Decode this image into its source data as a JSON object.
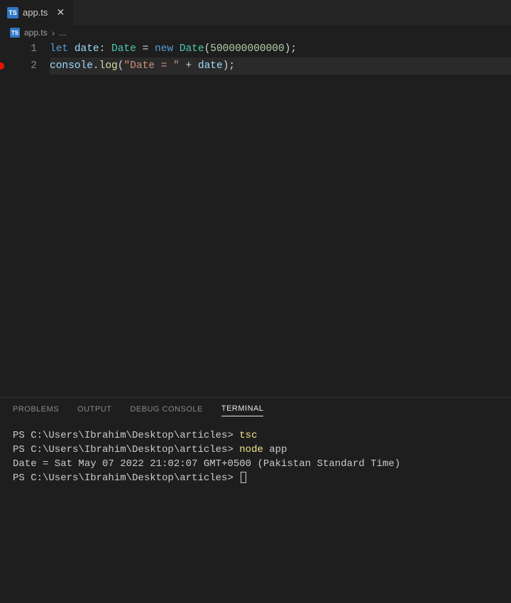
{
  "tab": {
    "icon_label": "TS",
    "filename": "app.ts"
  },
  "breadcrumb": {
    "icon_label": "TS",
    "filename": "app.ts",
    "chevron": "›",
    "tail": "..."
  },
  "editor": {
    "line_numbers": [
      "1",
      "2"
    ],
    "line1": {
      "let": "let",
      "sp1": " ",
      "var": "date",
      "colon": ":",
      "sp2": " ",
      "type1": "Date",
      "sp3": " ",
      "eq": "=",
      "sp4": " ",
      "new": "new",
      "sp5": " ",
      "type2": "Date",
      "lparen": "(",
      "num": "500000000000",
      "rparen": ")",
      "semi": ";"
    },
    "line2": {
      "obj": "console",
      "dot": ".",
      "method": "log",
      "lparen": "(",
      "str": "\"Date = \"",
      "sp1": " ",
      "plus": "+",
      "sp2": " ",
      "var": "date",
      "rparen": ")",
      "semi": ";"
    }
  },
  "panel_tabs": {
    "problems": "PROBLEMS",
    "output": "OUTPUT",
    "debug_console": "DEBUG CONSOLE",
    "terminal": "TERMINAL"
  },
  "terminal": {
    "lines": [
      {
        "prompt": "PS C:\\Users\\Ibrahim\\Desktop\\articles> ",
        "cmd": "tsc",
        "arg": ""
      },
      {
        "prompt": "PS C:\\Users\\Ibrahim\\Desktop\\articles> ",
        "cmd": "node",
        "arg": " app"
      },
      {
        "plain": "Date = Sat May 07 2022 21:02:07 GMT+0500 (Pakistan Standard Time)"
      },
      {
        "prompt": "PS C:\\Users\\Ibrahim\\Desktop\\articles> ",
        "cursor": true
      }
    ]
  }
}
